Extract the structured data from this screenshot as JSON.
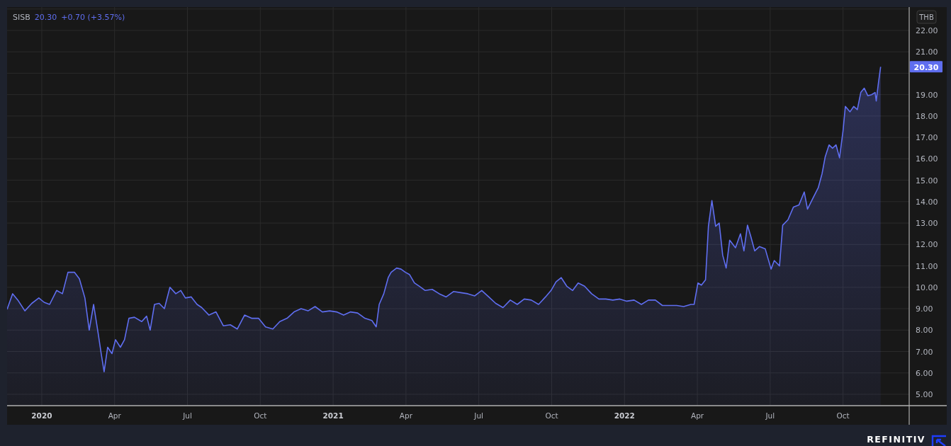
{
  "legend": {
    "price": "20.30",
    "change": "+0.70 (+3.57%)"
  },
  "price_axis": {
    "currency": "THB",
    "last_price_tag": "20.30"
  },
  "chart_data": {
    "type": "area",
    "grid": true,
    "xlim": [
      2019.881,
      2023.106
    ],
    "ylim": [
      4.47,
      23.09
    ],
    "yticks": [
      {
        "value": 5,
        "label": "5.00"
      },
      {
        "value": 6,
        "label": "6.00"
      },
      {
        "value": 7,
        "label": "7.00"
      },
      {
        "value": 8,
        "label": "8.00"
      },
      {
        "value": 9,
        "label": "9.00"
      },
      {
        "value": 10,
        "label": "10.00"
      },
      {
        "value": 11,
        "label": "11.00"
      },
      {
        "value": 12,
        "label": "12.00"
      },
      {
        "value": 13,
        "label": "13.00"
      },
      {
        "value": 14,
        "label": "14.00"
      },
      {
        "value": 15,
        "label": "15.00"
      },
      {
        "value": 16,
        "label": "16.00"
      },
      {
        "value": 17,
        "label": "17.00"
      },
      {
        "value": 18,
        "label": "18.00"
      },
      {
        "value": 19,
        "label": "19.00"
      },
      {
        "value": 21,
        "label": "21.00"
      },
      {
        "value": 22,
        "label": "22.00"
      }
    ],
    "xticks": [
      {
        "value": 2020,
        "label": "2020"
      },
      {
        "value": 2020.25,
        "label": "Apr"
      },
      {
        "value": 2020.5,
        "label": "Jul"
      },
      {
        "value": 2020.75,
        "label": "Oct"
      },
      {
        "value": 2021,
        "label": "2021"
      },
      {
        "value": 2021.25,
        "label": "Apr"
      },
      {
        "value": 2021.5,
        "label": "Jul"
      },
      {
        "value": 2021.75,
        "label": "Oct"
      },
      {
        "value": 2022,
        "label": "2022"
      },
      {
        "value": 2022.25,
        "label": "Apr"
      },
      {
        "value": 2022.5,
        "label": "Jul"
      },
      {
        "value": 2022.75,
        "label": "Oct"
      }
    ],
    "x": [
      2019.881,
      2019.9,
      2019.918,
      2019.942,
      2019.966,
      2019.99,
      2020.008,
      2020.027,
      2020.051,
      2020.071,
      2020.09,
      2020.112,
      2020.129,
      2020.148,
      2020.163,
      2020.178,
      2020.193,
      2020.204,
      2020.214,
      2020.226,
      2020.241,
      2020.253,
      2020.27,
      2020.284,
      2020.299,
      2020.318,
      2020.343,
      2020.36,
      2020.372,
      2020.387,
      2020.403,
      2020.421,
      2020.44,
      2020.46,
      2020.477,
      2020.493,
      2020.513,
      2020.533,
      2020.549,
      2020.574,
      2020.598,
      2020.623,
      2020.647,
      2020.671,
      2020.696,
      2020.72,
      2020.744,
      2020.768,
      2020.793,
      2020.817,
      2020.842,
      2020.866,
      2020.89,
      2020.914,
      2020.938,
      2020.963,
      2020.988,
      2021.012,
      2021.036,
      2021.06,
      2021.084,
      2021.109,
      2021.133,
      2021.148,
      2021.158,
      2021.174,
      2021.189,
      2021.199,
      2021.218,
      2021.233,
      2021.248,
      2021.262,
      2021.279,
      2021.296,
      2021.316,
      2021.34,
      2021.364,
      2021.388,
      2021.413,
      2021.438,
      2021.462,
      2021.486,
      2021.51,
      2021.534,
      2021.558,
      2021.583,
      2021.608,
      2021.632,
      2021.656,
      2021.68,
      2021.705,
      2021.729,
      2021.748,
      2021.765,
      2021.783,
      2021.802,
      2021.822,
      2021.841,
      2021.863,
      2021.887,
      2021.912,
      2021.936,
      2021.96,
      2021.984,
      2022.008,
      2022.033,
      2022.058,
      2022.082,
      2022.106,
      2022.13,
      2022.154,
      2022.179,
      2022.203,
      2022.228,
      2022.239,
      2022.252,
      2022.264,
      2022.278,
      2022.288,
      2022.3,
      2022.313,
      2022.325,
      2022.337,
      2022.349,
      2022.361,
      2022.381,
      2022.398,
      2022.41,
      2022.422,
      2022.434,
      2022.447,
      2022.463,
      2022.483,
      2022.503,
      2022.514,
      2022.532,
      2022.543,
      2022.561,
      2022.58,
      2022.599,
      2022.617,
      2022.628,
      2022.648,
      2022.665,
      2022.678,
      2022.689,
      2022.702,
      2022.714,
      2022.726,
      2022.738,
      2022.75,
      2022.758,
      2022.774,
      2022.787,
      2022.799,
      2022.811,
      2022.823,
      2022.835,
      2022.848,
      2022.86,
      2022.864,
      2022.872,
      2022.879
    ],
    "series": [
      {
        "name": "SISB",
        "color": "#5f6ef0",
        "values": [
          8.97,
          9.7,
          9.4,
          8.9,
          9.25,
          9.5,
          9.3,
          9.2,
          9.85,
          9.7,
          10.7,
          10.7,
          10.4,
          9.5,
          8.0,
          9.2,
          7.9,
          6.9,
          6.05,
          7.2,
          6.9,
          7.55,
          7.2,
          7.55,
          8.55,
          8.6,
          8.4,
          8.65,
          8.0,
          9.2,
          9.25,
          9.0,
          10.0,
          9.7,
          9.85,
          9.5,
          9.55,
          9.2,
          9.05,
          8.7,
          8.85,
          8.2,
          8.25,
          8.05,
          8.7,
          8.55,
          8.55,
          8.15,
          8.05,
          8.4,
          8.55,
          8.85,
          9.0,
          8.9,
          9.1,
          8.85,
          8.9,
          8.85,
          8.7,
          8.85,
          8.8,
          8.55,
          8.45,
          8.15,
          9.2,
          9.7,
          10.45,
          10.7,
          10.9,
          10.85,
          10.7,
          10.6,
          10.2,
          10.05,
          9.85,
          9.9,
          9.7,
          9.55,
          9.8,
          9.75,
          9.7,
          9.6,
          9.85,
          9.55,
          9.25,
          9.05,
          9.4,
          9.2,
          9.45,
          9.4,
          9.2,
          9.55,
          9.85,
          10.25,
          10.45,
          10.05,
          9.85,
          10.2,
          10.05,
          9.7,
          9.45,
          9.45,
          9.4,
          9.45,
          9.35,
          9.4,
          9.2,
          9.4,
          9.4,
          9.15,
          9.15,
          9.15,
          9.1,
          9.2,
          9.2,
          10.2,
          10.1,
          10.35,
          12.85,
          14.05,
          12.85,
          13.0,
          11.5,
          10.9,
          12.2,
          11.85,
          12.5,
          11.7,
          12.9,
          12.35,
          11.7,
          11.9,
          11.8,
          10.85,
          11.25,
          11.0,
          12.9,
          13.15,
          13.75,
          13.85,
          14.45,
          13.65,
          14.2,
          14.65,
          15.3,
          16.1,
          16.65,
          16.5,
          16.65,
          16.05,
          17.3,
          18.45,
          18.2,
          18.45,
          18.3,
          19.1,
          19.3,
          18.95,
          19.0,
          19.1,
          18.7,
          19.6,
          20.3
        ]
      }
    ]
  },
  "footer": {
    "brand": "REFINITIV"
  }
}
